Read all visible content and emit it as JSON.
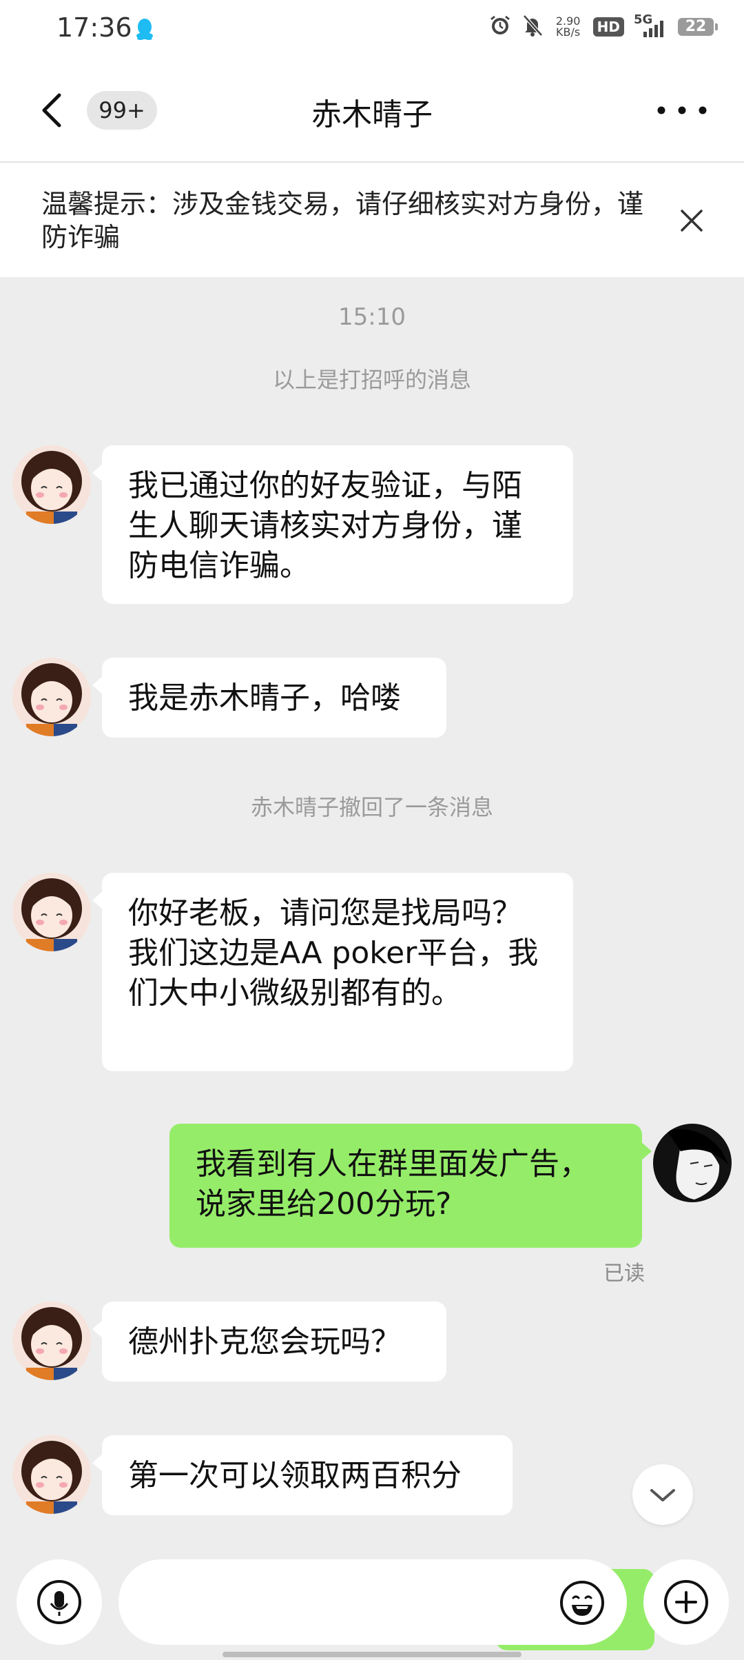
{
  "status_bar": {
    "time": "17:36",
    "speed_value": "2.90",
    "speed_unit": "KB/s",
    "hd_label": "HD",
    "network": "5G",
    "battery": "22",
    "icons": [
      "qq-penguin-icon",
      "alarm-icon",
      "mute-bell-icon",
      "signal-icon"
    ]
  },
  "header": {
    "back_icon": "chevron-left-icon",
    "unread_count": "99+",
    "title": "赤木晴子",
    "more_icon": "more-dots-icon"
  },
  "tip": {
    "text": "温馨提示：涉及金钱交易，请仔细核实对方身份，谨防诈骗",
    "close_icon": "close-icon"
  },
  "chat": {
    "timestamp": "15:10",
    "greeting_note": "以上是打招呼的消息",
    "recall_note": "赤木晴子撤回了一条消息",
    "read_status": "已读",
    "messages": [
      {
        "from": "other",
        "text": "我已通过你的好友验证，与陌生人聊天请核实对方身份，谨防电信诈骗。"
      },
      {
        "from": "other",
        "text": "我是赤木晴子，哈喽"
      },
      {
        "from": "other",
        "text": "你好老板，请问您是找局吗？我们这边是AA poker平台，我们大中小微级别都有的。"
      },
      {
        "from": "me",
        "text": "我看到有人在群里面发广告，说家里给200分玩?"
      },
      {
        "from": "other",
        "text": "德州扑克您会玩吗？"
      },
      {
        "from": "other",
        "text": "第一次可以领取两百积分"
      }
    ]
  },
  "input_bar": {
    "placeholder": "",
    "icons": [
      "microphone-icon",
      "emoji-icon",
      "plus-icon",
      "scroll-down-chevron-icon"
    ]
  },
  "colors": {
    "background": "#ededed",
    "my_bubble": "#95ec69",
    "other_bubble": "#ffffff",
    "muted_text": "#9a9a9a"
  }
}
